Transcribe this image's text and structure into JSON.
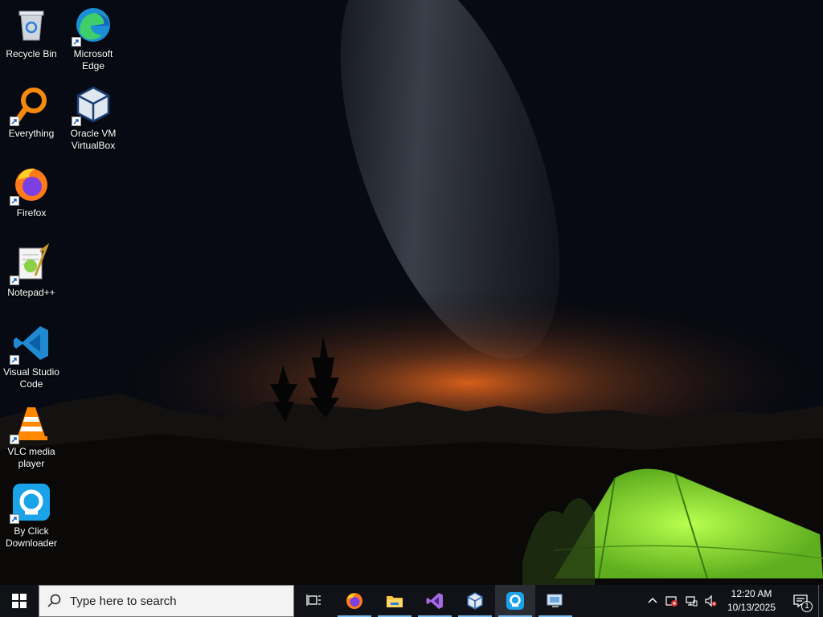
{
  "desktop": {
    "icons": [
      {
        "label": "Recycle Bin"
      },
      {
        "label": "Microsoft Edge"
      },
      {
        "label": "Everything"
      },
      {
        "label": "Oracle VM VirtualBox"
      },
      {
        "label": "Firefox"
      },
      {
        "label": "Notepad++"
      },
      {
        "label": "Visual Studio Code"
      },
      {
        "label": "VLC media player"
      },
      {
        "label": "By Click Downloader"
      }
    ]
  },
  "taskbar": {
    "search_placeholder": "Type here to search",
    "apps": [
      {
        "icon": "firefox-icon"
      },
      {
        "icon": "file-explorer-icon"
      },
      {
        "icon": "visual-studio-icon"
      },
      {
        "icon": "virtualbox-icon"
      },
      {
        "icon": "byclick-downloader-icon"
      },
      {
        "icon": "remote-desktop-icon"
      }
    ]
  },
  "tray": {
    "time": "12:20 AM",
    "date": "10/13/2025",
    "notification_count": "1"
  },
  "colors": {
    "taskbar": "#101217",
    "accent": "#76b9ed",
    "sky": "#05070c",
    "horizon_glow": "#e0631c",
    "tent": "#8fe23a"
  }
}
